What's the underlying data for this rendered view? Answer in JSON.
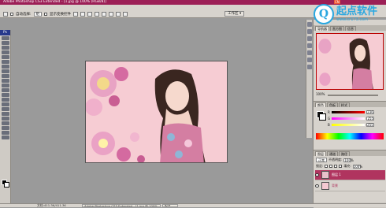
{
  "window": {
    "title": "Adobe Photoshop CS3 Extended - [1.jpg @ 100% (RGB/8)]"
  },
  "watermark": {
    "mark": "Q",
    "name": "起点软件",
    "tag": "CN",
    "domain": "www.cr173.com"
  },
  "options": {
    "auto_select": "自动选择:",
    "auto_select_value": "组",
    "show_transform": "显示变换控件",
    "workspace": "工作区 ▾"
  },
  "toolbox": {
    "badge": "Ps"
  },
  "status": {
    "doc_info": "文档:411.3K/411.3K",
    "task_1": "Adobe Photoshop CS3 Extended - [1.jpg @ 100% ...",
    "task_2": "起点"
  },
  "navigator": {
    "tabs": [
      "导航器",
      "直方图",
      "信息"
    ],
    "zoom": "100%"
  },
  "color_panel": {
    "tabs": [
      "颜色",
      "色板",
      "样式"
    ],
    "r_label": "R",
    "g_label": "G",
    "b_label": "B",
    "r": "236",
    "g": "255",
    "b": "255"
  },
  "layers": {
    "tabs": [
      "图层",
      "通道",
      "路径"
    ],
    "blend_mode": "正常",
    "opacity_label": "不透明度:",
    "opacity": "100%",
    "lock_label": "锁定:",
    "fill_label": "填充:",
    "fill": "100%",
    "items": [
      {
        "name": "图层 1",
        "active": true
      },
      {
        "name": "背景",
        "active": false
      }
    ]
  },
  "colors": {
    "accent": "#9c1f56",
    "layer_active": "#b0345f",
    "panel": "#d7d3cd",
    "workspace": "#9a9a9a"
  }
}
